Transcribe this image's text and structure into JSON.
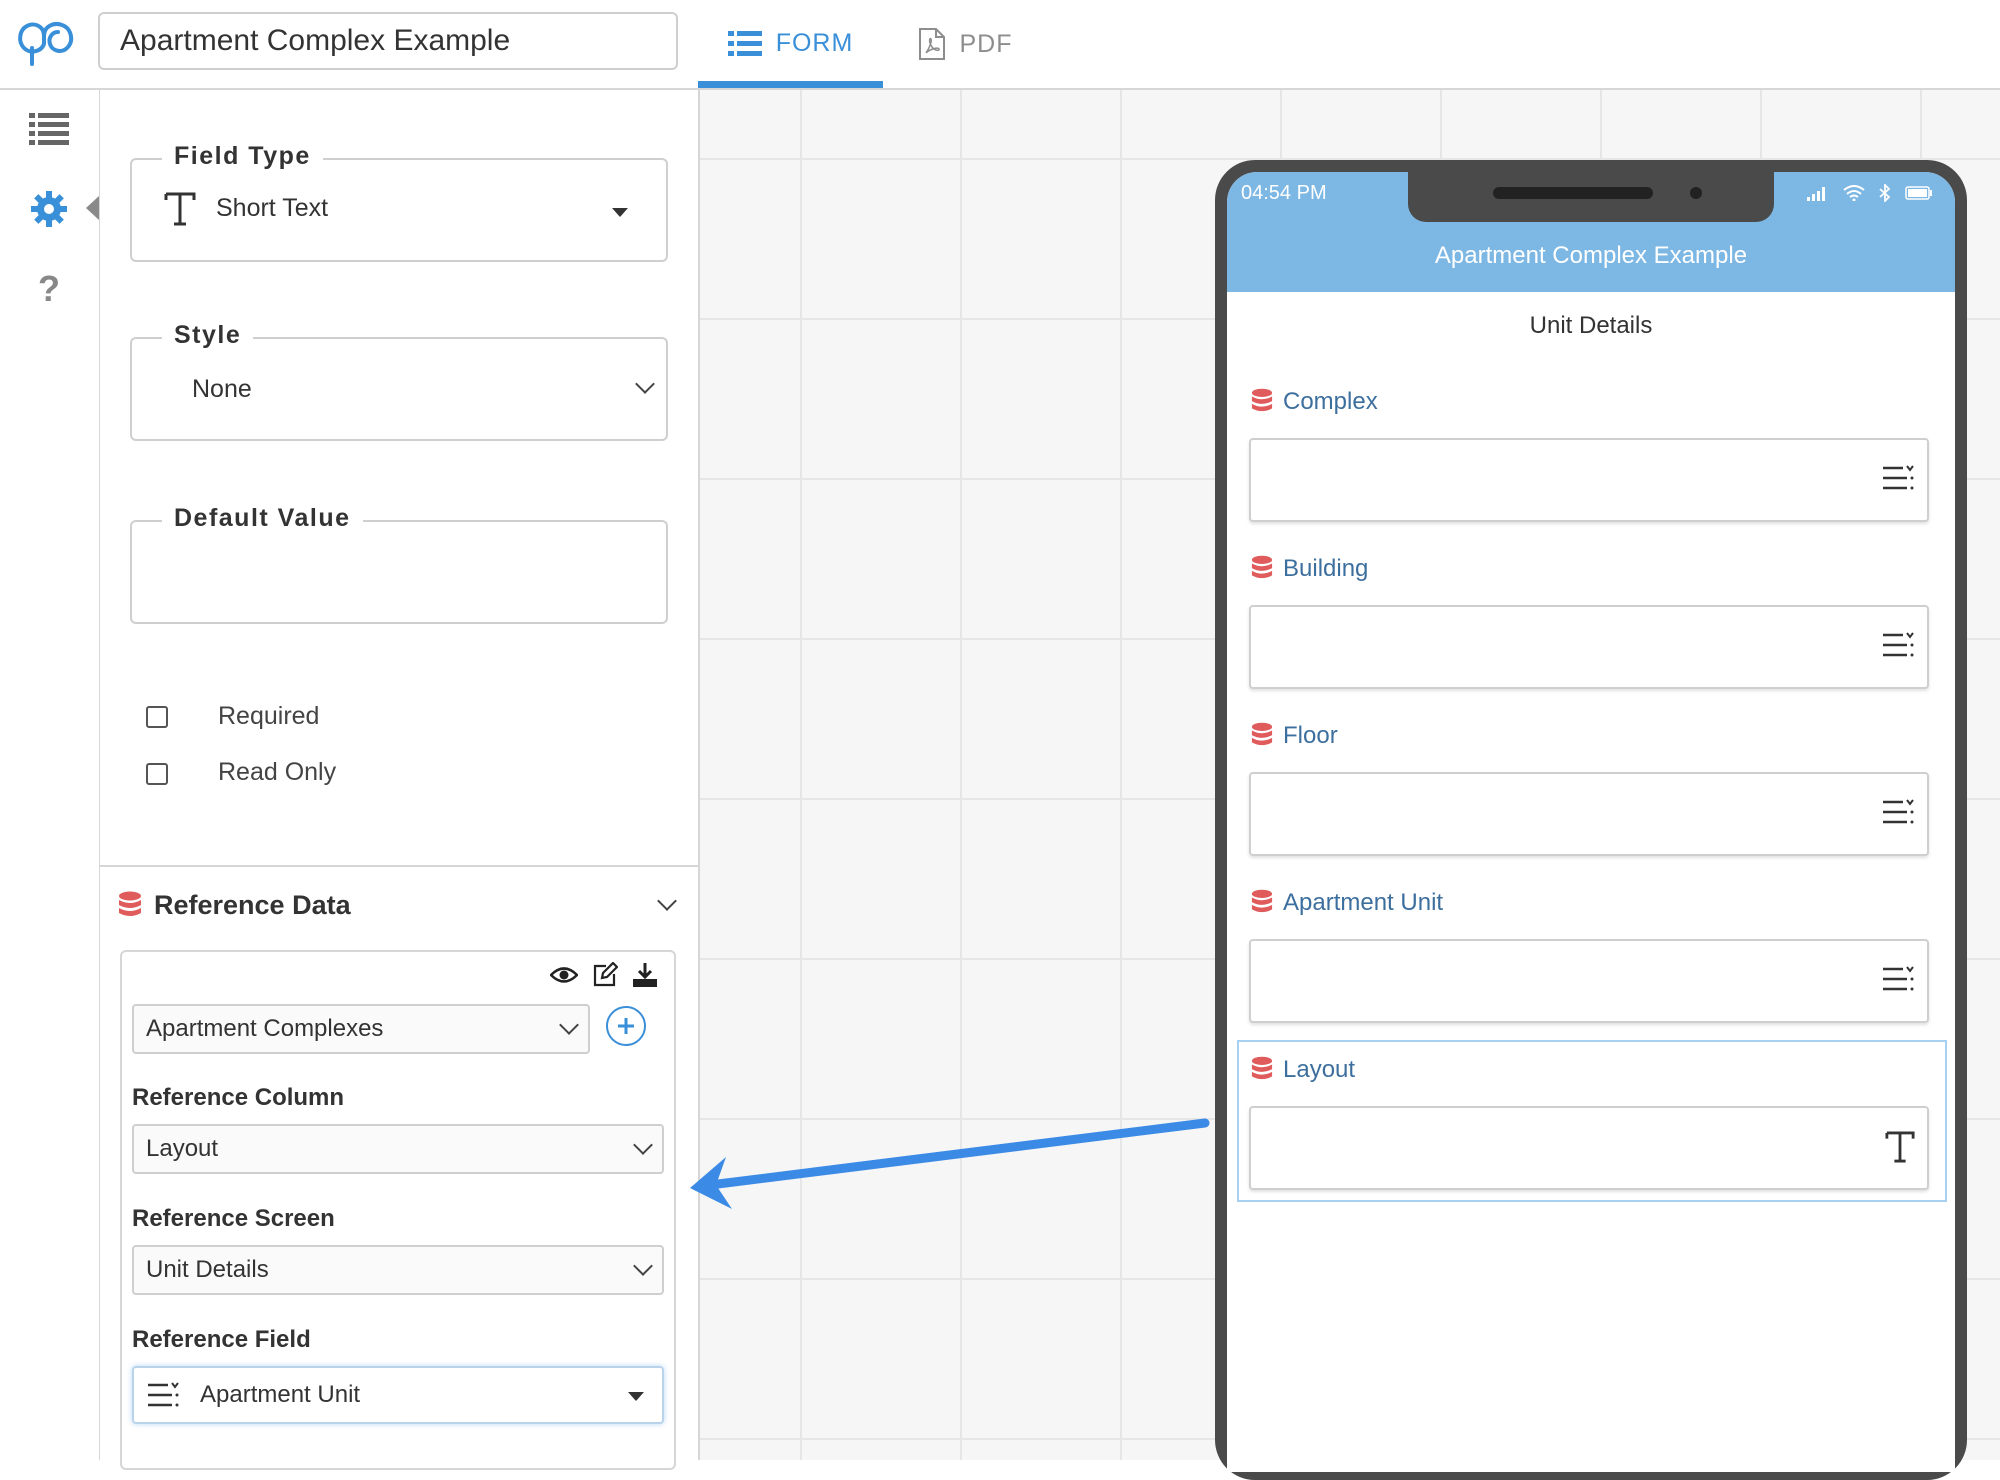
{
  "header": {
    "form_title": "Apartment Complex Example",
    "tabs": [
      {
        "label": "FORM",
        "icon": "list-icon",
        "active": true
      },
      {
        "label": "PDF",
        "icon": "pdf-icon",
        "active": false
      }
    ],
    "accent_color": "#3a8fd9"
  },
  "rail": {
    "items": [
      {
        "icon": "list-icon"
      },
      {
        "icon": "gear-icon",
        "active": true
      },
      {
        "icon": "help-icon",
        "glyph": "?"
      }
    ]
  },
  "panel": {
    "field_type": {
      "legend": "Field Type",
      "value": "Short Text"
    },
    "style": {
      "legend": "Style",
      "value": "None"
    },
    "default_value": {
      "legend": "Default Value",
      "value": ""
    },
    "checkboxes": [
      {
        "label": "Required",
        "checked": false
      },
      {
        "label": "Read Only",
        "checked": false
      }
    ],
    "reference": {
      "title": "Reference Data",
      "dataset": "Apartment Complexes",
      "column_label": "Reference Column",
      "column_value": "Layout",
      "screen_label": "Reference Screen",
      "screen_value": "Unit Details",
      "field_label": "Reference Field",
      "field_value": "Apartment Unit"
    }
  },
  "phone": {
    "time": "04:54 PM",
    "app_title": "Apartment Complex Example",
    "screen_title": "Unit Details",
    "fields": [
      {
        "label": "Complex",
        "icon": "dropdown-list-icon"
      },
      {
        "label": "Building",
        "icon": "dropdown-list-icon"
      },
      {
        "label": "Floor",
        "icon": "dropdown-list-icon"
      },
      {
        "label": "Apartment Unit",
        "icon": "dropdown-list-icon"
      },
      {
        "label": "Layout",
        "icon": "text-type-icon",
        "selected": true
      }
    ],
    "header_color": "#7db7e3",
    "database_icon_color": "#e05b5b"
  }
}
